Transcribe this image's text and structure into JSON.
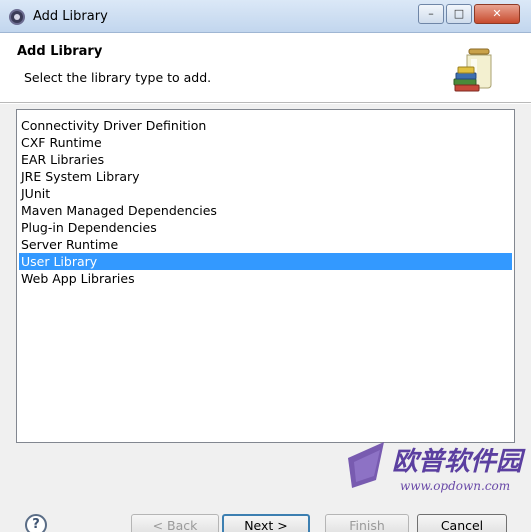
{
  "window": {
    "title": "Add Library",
    "minimize_glyph": "–",
    "maximize_glyph": "□",
    "close_glyph": "✕"
  },
  "header": {
    "title": "Add Library",
    "description": "Select the library type to add.",
    "image_icon": "library-jar-books-icon"
  },
  "library_types": [
    {
      "label": "Connectivity Driver Definition",
      "selected": false
    },
    {
      "label": "CXF Runtime",
      "selected": false
    },
    {
      "label": "EAR Libraries",
      "selected": false
    },
    {
      "label": "JRE System Library",
      "selected": false
    },
    {
      "label": "JUnit",
      "selected": false
    },
    {
      "label": "Maven Managed Dependencies",
      "selected": false
    },
    {
      "label": "Plug-in Dependencies",
      "selected": false
    },
    {
      "label": "Server Runtime",
      "selected": false
    },
    {
      "label": "User Library",
      "selected": true
    },
    {
      "label": "Web App Libraries",
      "selected": false
    }
  ],
  "buttons": {
    "help": "?",
    "back": "< Back",
    "next": "Next >",
    "finish": "Finish",
    "cancel": "Cancel"
  },
  "watermark": {
    "cn_text": "欧普软件园",
    "url_text": "www.opdown.com"
  },
  "colors": {
    "selection": "#3399ff",
    "dialog_bg": "#f0f0f0",
    "titlebar": "#c2d6ee"
  }
}
